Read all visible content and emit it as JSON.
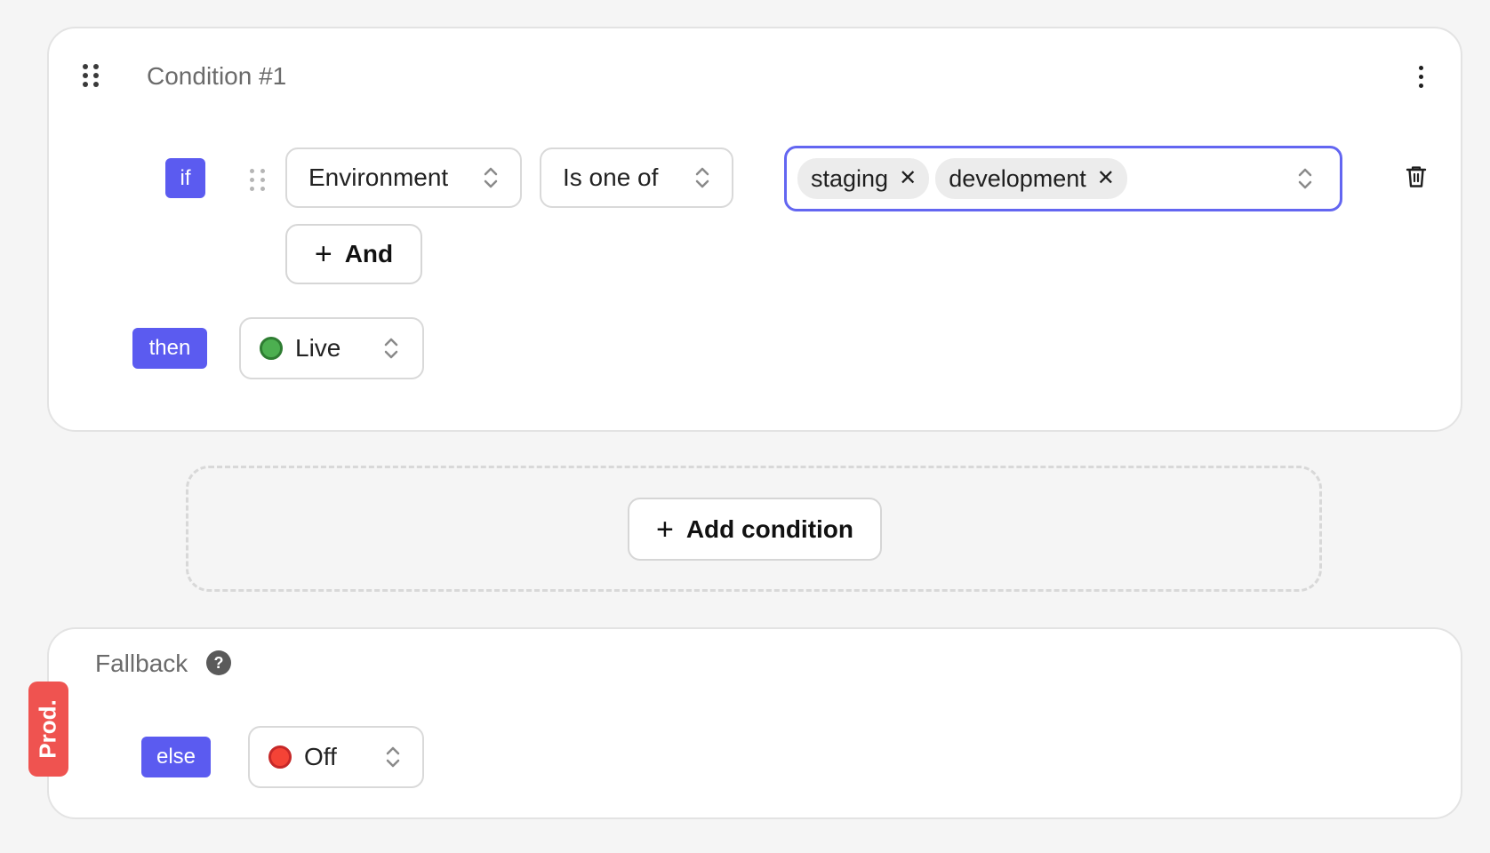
{
  "condition": {
    "title": "Condition #1",
    "if_label": "if",
    "then_label": "then",
    "attribute": "Environment",
    "operator": "Is one of",
    "values": [
      "staging",
      "development"
    ],
    "tag_remove_glyph": "✕",
    "and_button": "And",
    "plus_glyph": "+",
    "outcome": {
      "label": "Live",
      "color": "#4caf50"
    }
  },
  "add_condition": {
    "label": "Add condition"
  },
  "fallback": {
    "title": "Fallback",
    "help_glyph": "?",
    "else_label": "else",
    "outcome": {
      "label": "Off",
      "color": "#f44336"
    }
  },
  "environment_badge": {
    "label": "Prod.",
    "color": "#ef5350"
  },
  "colors": {
    "accent": "#5b5bf0",
    "focus_border": "#6366f1",
    "background": "#f5f5f5"
  },
  "icons": [
    "drag-handle-icon",
    "more-vertical-icon",
    "chevrons-updown-icon",
    "close-icon",
    "plus-icon",
    "trash-icon",
    "help-icon",
    "status-dot-icon"
  ]
}
